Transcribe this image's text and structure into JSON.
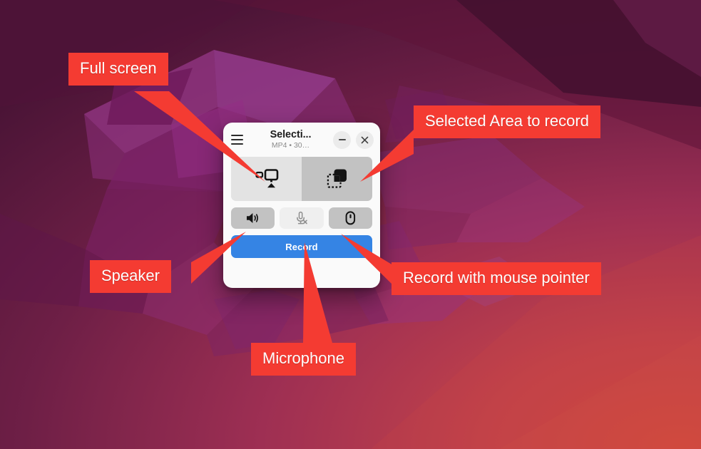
{
  "window": {
    "title": "Selecti...",
    "subtitle": "MP4 • 30…",
    "menu_icon": "hamburger-menu-icon",
    "minimize_label": "–",
    "close_label": "×",
    "mode_buttons": [
      {
        "name": "fullscreen-mode",
        "icon": "monitor-fullscreen-icon",
        "active": false
      },
      {
        "name": "selection-area-mode",
        "icon": "selection-area-icon",
        "active": true
      }
    ],
    "toggle_buttons": [
      {
        "name": "speaker-toggle",
        "icon": "speaker-icon",
        "state": "on"
      },
      {
        "name": "microphone-toggle",
        "icon": "microphone-muted-icon",
        "state": "off"
      },
      {
        "name": "mouse-pointer-toggle",
        "icon": "mouse-pointer-icon",
        "state": "on"
      }
    ],
    "record_label": "Record"
  },
  "annotations": [
    {
      "id": "fullscreen",
      "label": "Full screen"
    },
    {
      "id": "area",
      "label": "Selected Area to record"
    },
    {
      "id": "speaker",
      "label": "Speaker"
    },
    {
      "id": "mouse",
      "label": "Record with mouse pointer"
    },
    {
      "id": "mic",
      "label": "Microphone"
    }
  ],
  "colors": {
    "callout_red": "#f43b32",
    "record_blue": "#3584e4",
    "window_bg": "#fafafa",
    "button_active": "#c2c2c2",
    "button_inactive": "#e3e3e3"
  }
}
